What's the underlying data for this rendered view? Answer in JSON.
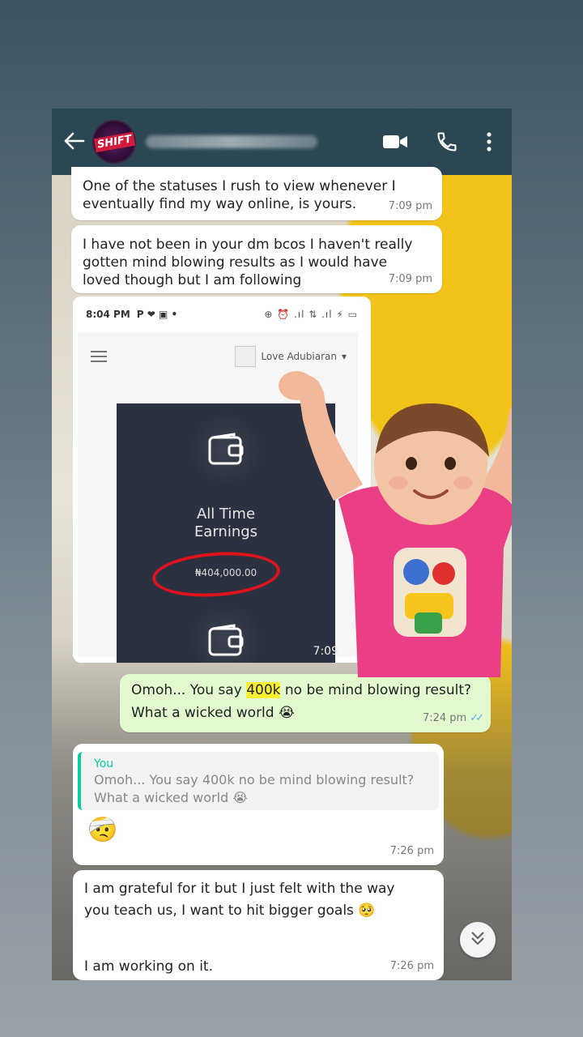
{
  "header": {
    "contact_avatar_text": "SHIFT",
    "contact_name": "",
    "back_icon": "arrow-left-icon",
    "video_icon": "video-camera-icon",
    "call_icon": "phone-icon",
    "menu_icon": "more-vert-icon",
    "bg_color": "#2c4754"
  },
  "messages": [
    {
      "text": "One of the statuses I rush to view whenever I eventually find my way online, is yours.",
      "time": "7:09 pm",
      "direction": "incoming"
    },
    {
      "text": "I have not been in your dm bcos I haven't really gotten mind blowing results as I would have loved though but I am following",
      "time": "7:09 pm",
      "direction": "incoming"
    }
  ],
  "image_message": {
    "status_time": "8:04 PM",
    "status_icons": "P ❤ ▣ •",
    "status_right": "⊕ ⏰ .ıl ⇅ .ıl ⚡ ▭",
    "user_chip": "Love Adubiaran",
    "earnings_label_1": "All Time",
    "earnings_label_2": "Earnings",
    "earnings_value": "₦404,000.00",
    "time": "7:09"
  },
  "reply_out": {
    "text_before": "Omoh... You say ",
    "highlight": "400k",
    "text_after": " no be mind blowing result?",
    "line2": "What a wicked world 😭",
    "time": "7:24 pm",
    "ticks": "✓✓"
  },
  "reply_in": {
    "quote_author": "You",
    "quote_line1": "Omoh... You say 400k no be mind blowing result?",
    "quote_line2": "What a wicked world 😭",
    "emoji": "🤕",
    "time": "7:26 pm"
  },
  "last_message": {
    "text": "I am grateful for it but I just felt with the way you teach us, I want to hit bigger goals 🥺",
    "text2": "I am working on it.",
    "time": "7:26 pm"
  },
  "accent": "#06cf9c",
  "tick_color": "#4fb3f0"
}
